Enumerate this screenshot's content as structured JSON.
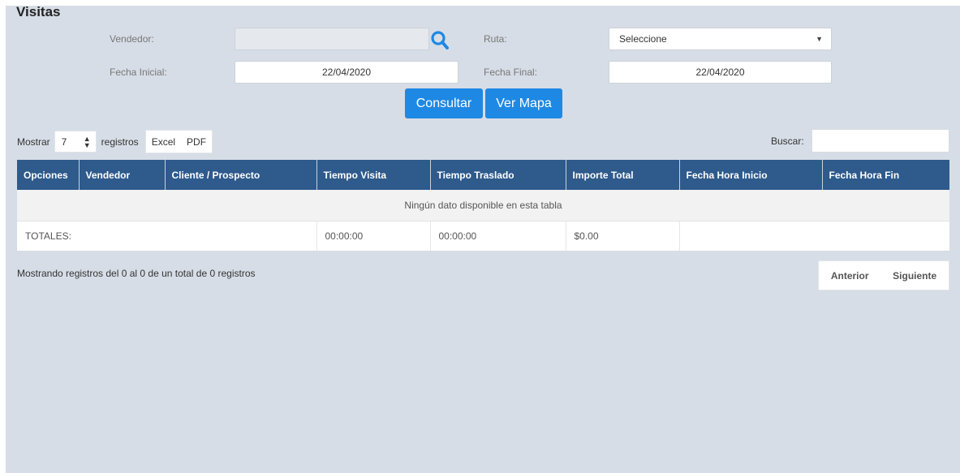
{
  "page": {
    "title": "Visitas"
  },
  "form": {
    "vendedor_label": "Vendedor:",
    "vendedor_value": "",
    "ruta_label": "Ruta:",
    "ruta_value": "Seleccione",
    "fecha_inicial_label": "Fecha Inicial:",
    "fecha_inicial_value": "22/04/2020",
    "fecha_final_label": "Fecha Final:",
    "fecha_final_value": "22/04/2020",
    "consultar_label": "Consultar",
    "ver_mapa_label": "Ver Mapa"
  },
  "controls": {
    "mostrar_label": "Mostrar",
    "length_value": "7",
    "registros_label": "registros",
    "excel_label": "Excel",
    "pdf_label": "PDF",
    "buscar_label": "Buscar:",
    "buscar_value": ""
  },
  "table": {
    "headers": [
      "Opciones",
      "Vendedor",
      "Cliente / Prospecto",
      "Tiempo Visita",
      "Tiempo Traslado",
      "Importe Total",
      "Fecha Hora Inicio",
      "Fecha Hora Fin"
    ],
    "empty_message": "Ningún dato disponible en esta tabla",
    "totals": {
      "label": "TOTALES:",
      "tiempo_visita": "00:00:00",
      "tiempo_traslado": "00:00:00",
      "importe_total": "$0.00"
    }
  },
  "footer": {
    "info": "Mostrando registros del 0 al 0 de un total de 0 registros",
    "anterior_label": "Anterior",
    "siguiente_label": "Siguiente"
  },
  "colors": {
    "accent": "#1e88e5",
    "header": "#2e5a8c",
    "background": "#d7dde6"
  },
  "icons": {
    "search": "search-icon",
    "select_arrow": "caret-down-icon",
    "sort_arrows": "sort-arrows-icon"
  }
}
